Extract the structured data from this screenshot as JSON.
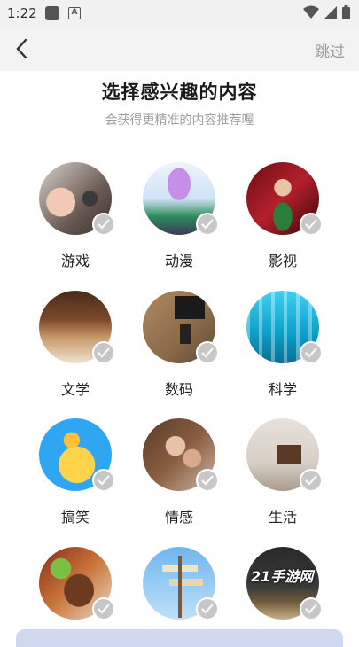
{
  "status": {
    "time": "1:22",
    "badge": "A"
  },
  "header": {
    "skip_label": "跳过"
  },
  "page": {
    "title": "选择感兴趣的内容",
    "subtitle": "会获得更精准的内容推荐喔"
  },
  "categories": [
    {
      "label": "游戏"
    },
    {
      "label": "动漫"
    },
    {
      "label": "影视"
    },
    {
      "label": "文学"
    },
    {
      "label": "数码"
    },
    {
      "label": "科学"
    },
    {
      "label": "搞笑"
    },
    {
      "label": "情感"
    },
    {
      "label": "生活"
    },
    {
      "label": ""
    },
    {
      "label": ""
    },
    {
      "label": ""
    }
  ],
  "watermark": "21手游网"
}
